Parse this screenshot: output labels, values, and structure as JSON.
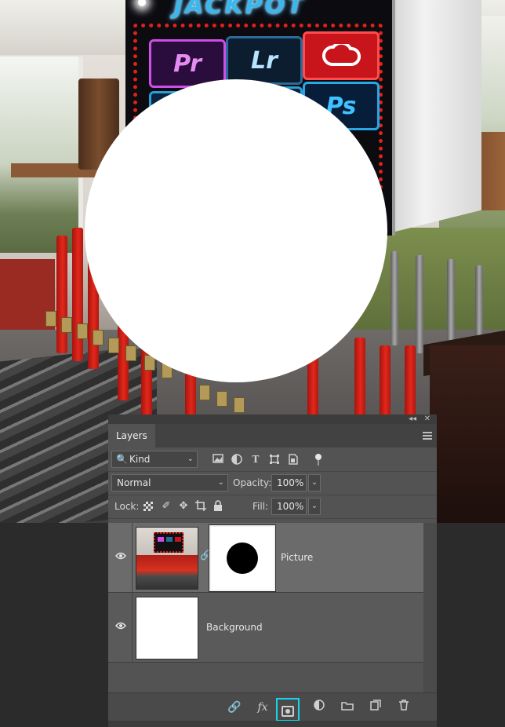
{
  "canvas": {
    "sign_title": "JACKPOT",
    "tiles": [
      "Pr",
      "Lr",
      "Ps"
    ]
  },
  "panel": {
    "collapse_glyph": "◂◂",
    "close_glyph": "✕",
    "tab_label": "Layers",
    "filter": {
      "kind_label": "Kind",
      "icons": [
        "image-filter-icon",
        "adjustment-filter-icon",
        "type-filter-icon",
        "shape-filter-icon",
        "smart-object-filter-icon",
        "filter-toggle-icon"
      ]
    },
    "blend_mode": "Normal",
    "opacity_label": "Opacity:",
    "opacity_value": "100%",
    "lock_label": "Lock:",
    "fill_label": "Fill:",
    "fill_value": "100%",
    "layers": [
      {
        "name": "Picture",
        "has_mask": true,
        "visible": true,
        "selected": true
      },
      {
        "name": "Background",
        "has_mask": false,
        "visible": true,
        "selected": false
      }
    ],
    "footer_icons": [
      "link-layers-icon",
      "fx-icon",
      "add-mask-icon",
      "adjustment-layer-icon",
      "group-folder-icon",
      "new-layer-icon",
      "trash-icon"
    ],
    "footer_fx_text": "fx",
    "highlight_color": "#19d3e6"
  }
}
